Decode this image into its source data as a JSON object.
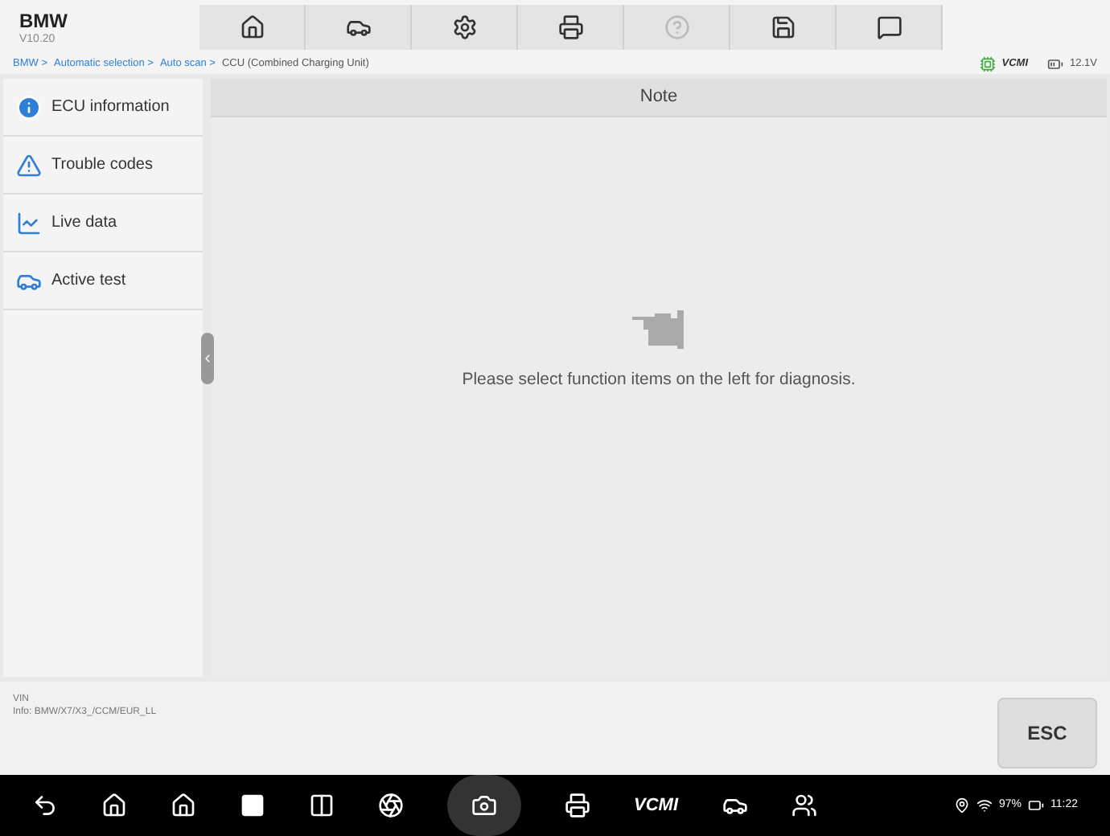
{
  "header": {
    "title": "BMW",
    "version": "V10.20"
  },
  "toolbar": [
    {
      "kind": "home",
      "disabled": false
    },
    {
      "kind": "vehicle",
      "disabled": false
    },
    {
      "kind": "settings",
      "disabled": false
    },
    {
      "kind": "print",
      "disabled": false
    },
    {
      "kind": "help",
      "disabled": true
    },
    {
      "kind": "save",
      "disabled": false
    },
    {
      "kind": "message",
      "disabled": false
    }
  ],
  "breadcrumb": [
    {
      "text": "BMW >",
      "link": true
    },
    {
      "text": "Automatic selection >",
      "link": true
    },
    {
      "text": "Auto scan >",
      "link": true
    },
    {
      "text": "CCU (Combined Charging Unit)",
      "link": false
    }
  ],
  "status": {
    "vci": "VCMI",
    "voltage": "12.1V"
  },
  "sidebar": {
    "items": [
      {
        "kind": "info",
        "label": "ECU information",
        "selected": false
      },
      {
        "kind": "codes",
        "label": "Trouble codes",
        "selected": false
      },
      {
        "kind": "live",
        "label": "Live data",
        "selected": false
      },
      {
        "kind": "active",
        "label": "Active test",
        "selected": false
      }
    ]
  },
  "panel": {
    "title": "Note",
    "message": "Please select function items on the left for diagnosis."
  },
  "footer": {
    "vin": "VIN",
    "info": "Info: BMW/X7/X3_/CCM/EUR_LL",
    "esc": "ESC"
  },
  "navbar": {
    "vcmi": "VCMI",
    "battery": "97%",
    "time": "11:22"
  }
}
